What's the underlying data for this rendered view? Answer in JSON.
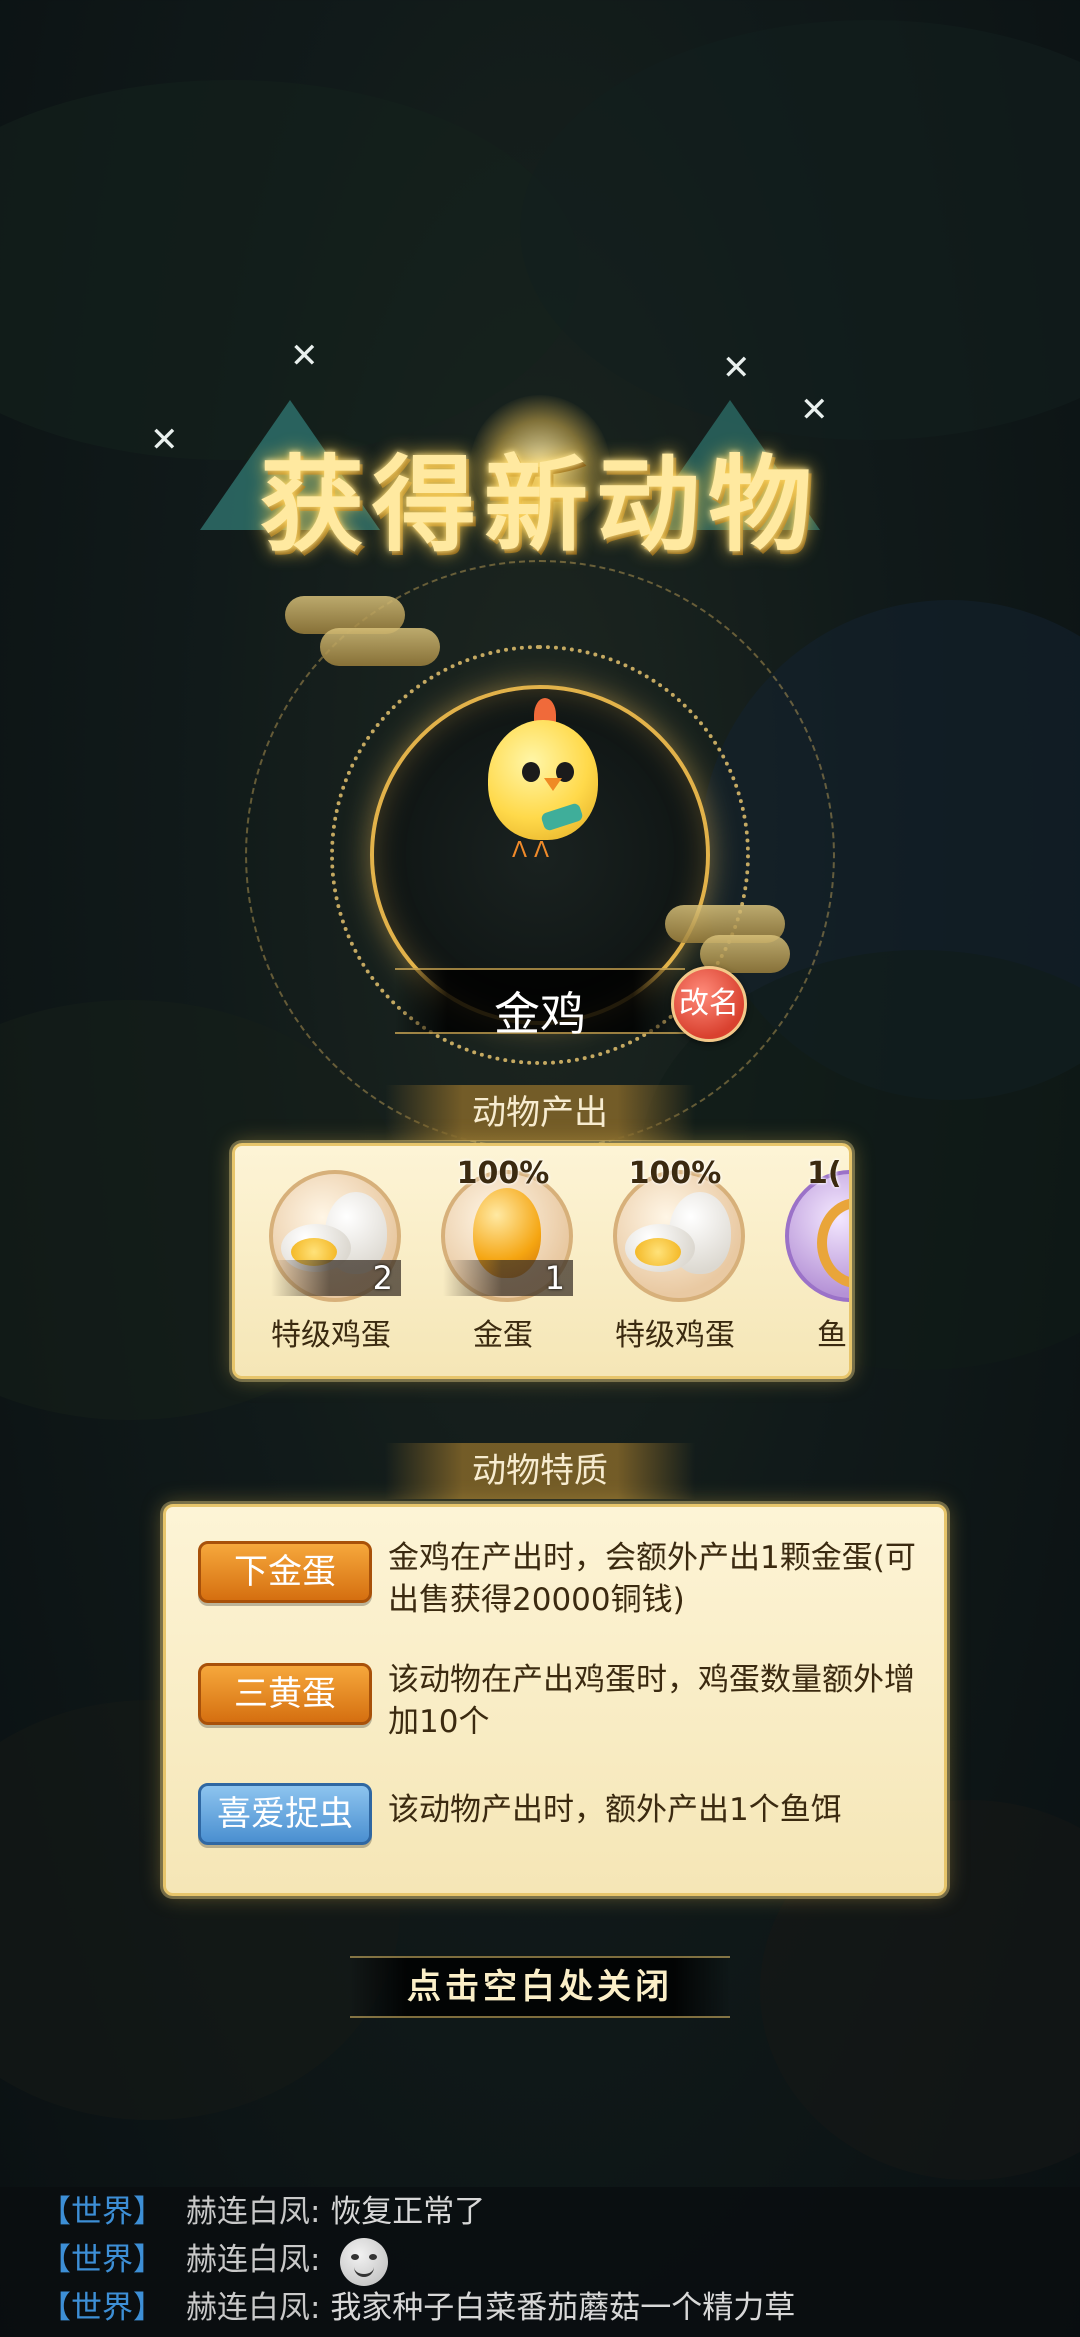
{
  "title": "获得新动物",
  "animal": {
    "name": "金鸡",
    "rename_label": "改名"
  },
  "produce": {
    "header": "动物产出",
    "items": [
      {
        "label": "特级鸡蛋",
        "count": "2",
        "percent": ""
      },
      {
        "label": "金蛋",
        "count": "1",
        "percent": "100%"
      },
      {
        "label": "特级鸡蛋",
        "count": "",
        "percent": "100%"
      },
      {
        "label": "鱼",
        "count": "",
        "percent": "1("
      }
    ]
  },
  "traits": {
    "header": "动物特质",
    "items": [
      {
        "badge": "下金蛋",
        "text": "金鸡在产出时，会额外产出1颗金蛋(可出售获得20000铜钱)",
        "color": "orange"
      },
      {
        "badge": "三黄蛋",
        "text": "该动物在产出鸡蛋时，鸡蛋数量额外增加10个",
        "color": "orange"
      },
      {
        "badge": "喜爱捉虫",
        "text": "该动物产出时，额外产出1个鱼饵",
        "color": "blue"
      }
    ]
  },
  "close_hint": "点击空白处关闭",
  "chat": [
    {
      "channel": "【世界】",
      "user": "赫连白凤:",
      "message": "恢复正常了"
    },
    {
      "channel": "【世界】",
      "user": "赫连白凤:",
      "message": ""
    },
    {
      "channel": "【世界】",
      "user": "赫连白凤:",
      "message": "我家种子白菜番茄蘑菇一个精力草"
    }
  ],
  "colors": {
    "gold": "#e2b24a",
    "panel": "#fdf4d6",
    "badge_orange": "#e0801c",
    "badge_blue": "#5b9ed9",
    "chat_channel": "#3d8fd6"
  }
}
